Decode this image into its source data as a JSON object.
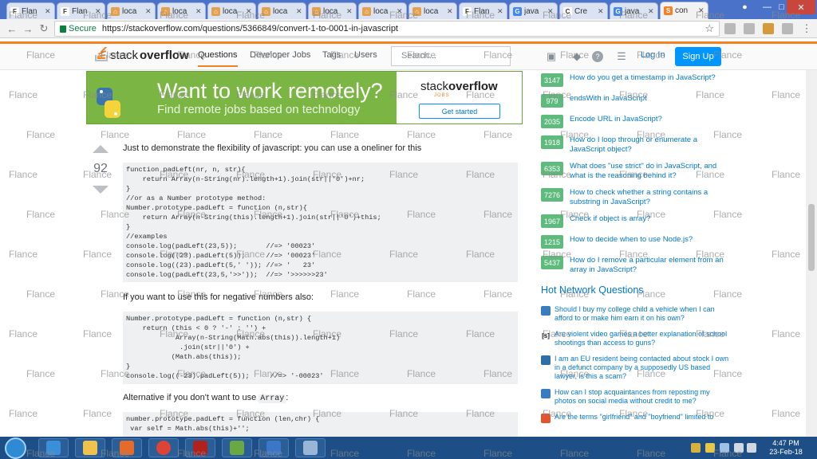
{
  "browser": {
    "tabs": [
      {
        "title": "Flan",
        "color": "#ffffff",
        "glyph": "F"
      },
      {
        "title": "Flan",
        "color": "#ffffff",
        "glyph": "F"
      },
      {
        "title": "loca",
        "color": "#e4a04b",
        "glyph": "⌂"
      },
      {
        "title": "loca",
        "color": "#e4a04b",
        "glyph": "⌂"
      },
      {
        "title": "loca",
        "color": "#e4a04b",
        "glyph": "⌂"
      },
      {
        "title": "loca",
        "color": "#e4a04b",
        "glyph": "⌂"
      },
      {
        "title": "loca",
        "color": "#e4a04b",
        "glyph": "⌂"
      },
      {
        "title": "loca",
        "color": "#e4a04b",
        "glyph": "⌂"
      },
      {
        "title": "loca",
        "color": "#e4a04b",
        "glyph": "⌂"
      },
      {
        "title": "Flan",
        "color": "#ffffff",
        "glyph": "F"
      },
      {
        "title": "java",
        "color": "#4285f4",
        "glyph": "G"
      },
      {
        "title": "Cre",
        "color": "#ffffff",
        "glyph": "C"
      },
      {
        "title": "java",
        "color": "#4285f4",
        "glyph": "G"
      },
      {
        "title": "con",
        "color": "#f48024",
        "glyph": "S"
      }
    ],
    "active_tab": 13,
    "secure_label": "Secure",
    "url": "https://stackoverflow.com/questions/5366849/convert-1-to-0001-in-javascript"
  },
  "so_header": {
    "logo_text_light": "stack",
    "logo_text_bold": "overflow",
    "nav": [
      "Questions",
      "Developer Jobs",
      "Tags",
      "Users"
    ],
    "search_placeholder": "Search...",
    "login": "Log In",
    "signup": "Sign Up"
  },
  "banner": {
    "headline": "Want to work remotely?",
    "subline": "Find remote jobs based on technology",
    "logo_light": "stack",
    "logo_bold": "overflow",
    "logo_sub": "JOBS",
    "cta": "Get started"
  },
  "answer": {
    "votes": "92",
    "intro": "Just to demonstrate the flexibility of javascript: you can use a oneliner for this",
    "code1": "function padLeft(nr, n, str){\n    return Array(n-String(nr).length+1).join(str||'0')+nr;\n}\n//or as a Number prototype method:\nNumber.prototype.padLeft = function (n,str){\n    return Array(n-String(this).length+1).join(str||'0')+this;\n}\n//examples\nconsole.log(padLeft(23,5));       //=> '00023'\nconsole.log((23).padLeft(5));     //=> '00023'\nconsole.log((23).padLeft(5,' ')); //=> '   23'\nconsole.log(padLeft(23,5,'>>'));  //=> '>>>>>>23'",
    "para2": "If you want to use this for negative numbers also:",
    "code2": "Number.prototype.padLeft = function (n,str) {\n    return (this < 0 ? '-' : '') +\n            Array(n-String(Math.abs(this)).length+1)\n             .join(str||'0') +\n           (Math.abs(this));\n}\nconsole.log((-23).padLeft(5));     //=> '-00023'",
    "para3_before": "Alternative if you don't want to use ",
    "para3_code": "Array",
    "para3_after": ":",
    "code3": "number.prototype.padLeft = function (len,chr) {\n var self = Math.abs(this)+'';"
  },
  "sidebar": {
    "linked": [
      {
        "score": "3147",
        "title": "How do you get a timestamp in JavaScript?"
      },
      {
        "score": "979",
        "title": "endsWith in JavaScript"
      },
      {
        "score": "2035",
        "title": "Encode URL in JavaScript?"
      },
      {
        "score": "1918",
        "title": "How do I loop through or enumerate a JavaScript object?"
      },
      {
        "score": "6353",
        "title": "What does \"use strict\" do in JavaScript, and what is the reasoning behind it?"
      },
      {
        "score": "7276",
        "title": "How to check whether a string contains a substring in JavaScript?"
      },
      {
        "score": "1967",
        "title": "Check if object is array?"
      },
      {
        "score": "1215",
        "title": "How to decide when to use Node.js?"
      },
      {
        "score": "5437",
        "title": "How do I remove a particular element from an array in JavaScript?"
      }
    ],
    "hnq_title": "Hot Network Questions",
    "hnq": [
      {
        "site_color": "#3b7bbf",
        "glyph": "",
        "title": "Should I buy my college child a vehicle when I can afford to or make him earn it on his own?"
      },
      {
        "site_color": "#ffffff",
        "glyph": "[s]",
        "title": "Are violent video games a better explanation of school shootings than access to guns?"
      },
      {
        "site_color": "#2f6fa8",
        "glyph": "",
        "title": "I am an EU resident being contacted about stock I own in a defunct company by a supposedly US based lawyer, is this a scam?"
      },
      {
        "site_color": "#3b7bbf",
        "glyph": "",
        "title": "How can I stop acquaintances from reposting my photos on social media without credit to me?"
      },
      {
        "site_color": "#e0552b",
        "glyph": "",
        "title": "Are the terms \"girlfriend\" and \"boyfriend\" limited to"
      }
    ]
  },
  "watermark_text": "Flance",
  "taskbar": {
    "apps": [
      {
        "name": "internet-explorer",
        "color": "#3a8fd8"
      },
      {
        "name": "file-explorer",
        "color": "#f0c24b"
      },
      {
        "name": "media-player",
        "color": "#e46b2a"
      },
      {
        "name": "chrome",
        "color": "#db4437"
      },
      {
        "name": "filezilla",
        "color": "#b2221c"
      },
      {
        "name": "chart-app",
        "color": "#6aa843"
      },
      {
        "name": "network-app",
        "color": "#3b77c9"
      },
      {
        "name": "virtualbox",
        "color": "#9ab6d6"
      }
    ],
    "time": "4:47 PM",
    "date": "23-Feb-18"
  }
}
